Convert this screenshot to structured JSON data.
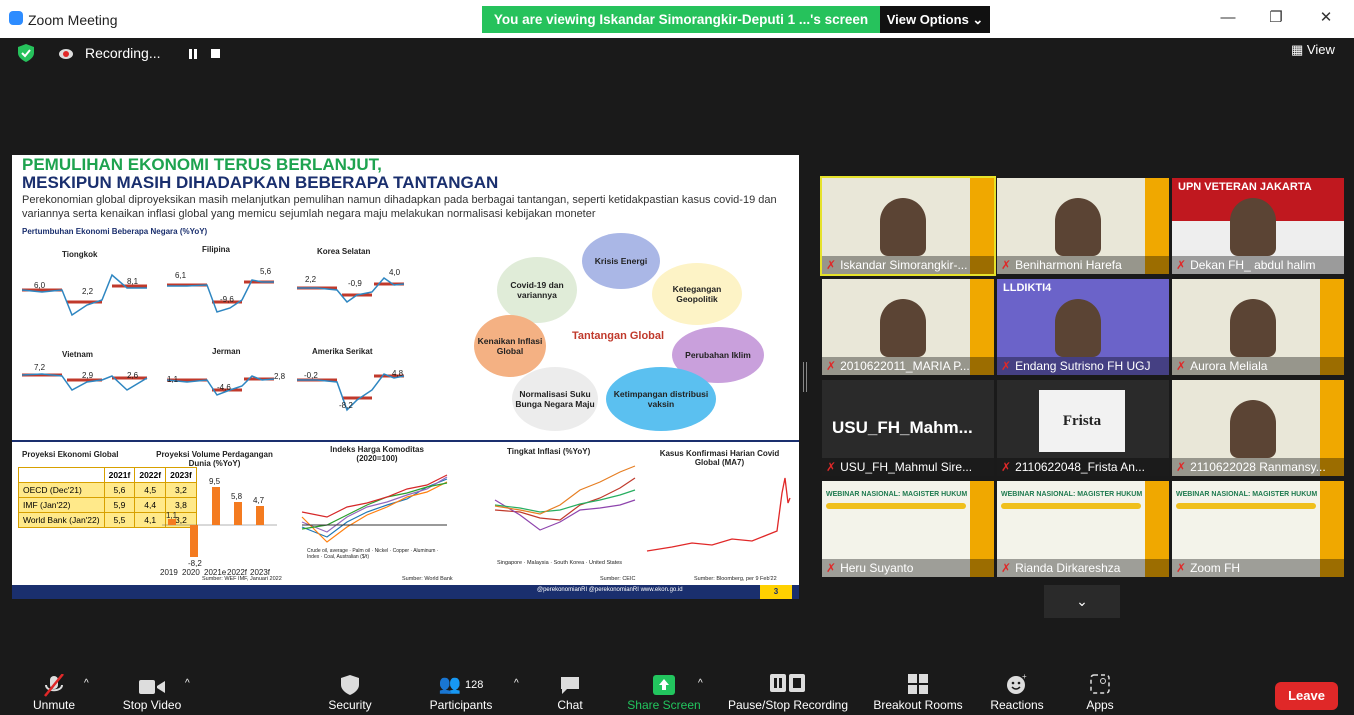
{
  "window": {
    "title": "Zoom Meeting"
  },
  "banner": {
    "text": "You are viewing Iskandar Simorangkir-Deputi 1 ...'s screen",
    "view_options": "View Options ⌄"
  },
  "recording": {
    "label": "Recording...",
    "view_label": "View"
  },
  "slide": {
    "title_line1": "PEMULIHAN EKONOMI TERUS BERLANJUT,",
    "title_line2": "MESKIPUN MASIH DIHADAPKAN BEBERAPA TANTANGAN",
    "paragraph": "Perekonomian global diproyeksikan masih melanjutkan pemulihan namun dihadapkan pada berbagai tantangan, seperti ketidakpastian kasus covid-19 dan variannya serta kenaikan inflasi global yang memicu sejumlah negara maju melakukan normalisasi kebijakan moneter",
    "growth_title": "Pertumbuhan Ekonomi Beberapa Negara (%YoY)",
    "countries": [
      "Tiongkok",
      "Filipina",
      "Korea Selatan",
      "Vietnam",
      "Jerman",
      "Amerika Serikat"
    ],
    "country_values": [
      [
        "6,0",
        "2,2",
        "8,1"
      ],
      [
        "6,1",
        "-9,6",
        "5,6"
      ],
      [
        "2,2",
        "-0,9",
        "4,0"
      ],
      [
        "7,2",
        "2,9",
        "2,6"
      ],
      [
        "1,1",
        "-4,6",
        "2,8"
      ],
      [
        "-0,2",
        "-8,2",
        "4,8"
      ]
    ],
    "challenges": [
      "Krisis Energi",
      "Covid-19 dan variannya",
      "Ketegangan Geopolitik",
      "Kenaikan Inflasi Global",
      "Perubahan Iklim",
      "Normalisasi Suku Bunga Negara Maju",
      "Ketimpangan distribusi vaksin"
    ],
    "challenges_center": "Tantangan Global",
    "proyeksi_title": "Proyeksi Ekonomi Global",
    "proyeksi_headers": [
      "",
      "2021f",
      "2022f",
      "2023f"
    ],
    "proyeksi_rows": [
      [
        "OECD (Dec'21)",
        "5,6",
        "4,5",
        "3,2"
      ],
      [
        "IMF (Jan'22)",
        "5,9",
        "4,4",
        "3,8"
      ],
      [
        "World Bank (Jan'22)",
        "5,5",
        "4,1",
        "3,2"
      ]
    ],
    "trade_title": "Proyeksi Volume Perdagangan Dunia (%YoY)",
    "trade_values": [
      "1,1",
      "-8,2",
      "9,5",
      "5,8",
      "4,7"
    ],
    "trade_years": [
      "2019",
      "2020",
      "2021e",
      "2022f",
      "2023f"
    ],
    "trade_source": "Sumber: WEF IMF, Januari 2022",
    "commodity_title": "Indeks Harga Komoditas (2020=100)",
    "commodity_legend": [
      "Crude oil, average",
      "Palm oil",
      "Nickel",
      "Copper",
      "Aluminum",
      "Index",
      "Coal, Australian ($/t)"
    ],
    "commodity_source": "Sumber: World Bank",
    "inflation_title": "Tingkat Inflasi (%YoY)",
    "inflation_legend": [
      "Singapore",
      "Malaysia",
      "South Korea",
      "United States"
    ],
    "inflation_source": "Sumber: CEIC",
    "covid_title": "Kasus Konfirmasi Harian Covid Global (MA7)",
    "covid_source": "Sumber: Bloomberg, per 9 Feb'22",
    "footer_text": "@perekonomianRI  @perekonomianRI  www.ekon.go.id",
    "page_number": "3"
  },
  "participants": [
    {
      "name": "Iskandar Simorangkir-...",
      "kind": "camera",
      "active": true
    },
    {
      "name": "Beniharmoni Harefa",
      "kind": "camera"
    },
    {
      "name": "Dekan FH_ abdul halim",
      "kind": "camera",
      "header": "UPN VETERAN JAKARTA"
    },
    {
      "name": "2010622011_MARIA P...",
      "kind": "camera"
    },
    {
      "name": "Endang Sutrisno FH UGJ",
      "kind": "camera",
      "header": "LLDIKTI4"
    },
    {
      "name": "Aurora Meliala",
      "kind": "camera"
    },
    {
      "name": "USU_FH_Mahmul Sire...",
      "kind": "text",
      "display": "USU_FH_Mahm..."
    },
    {
      "name": "2110622048_Frista An...",
      "kind": "card",
      "display": "Frista"
    },
    {
      "name": "2110622028 Ranmansy...",
      "kind": "camera"
    },
    {
      "name": "Heru Suyanto",
      "kind": "webinar"
    },
    {
      "name": "Rianda Dirkareshza",
      "kind": "webinar"
    },
    {
      "name": "Zoom FH",
      "kind": "webinar"
    }
  ],
  "webinar_text": "WEBINAR NASIONAL: MAGISTER HUKUM",
  "toolbar": {
    "unmute": "Unmute",
    "stop_video": "Stop Video",
    "security": "Security",
    "participants": "Participants",
    "participants_count": "128",
    "chat": "Chat",
    "share_screen": "Share Screen",
    "pause_recording": "Pause/Stop Recording",
    "breakout": "Breakout Rooms",
    "reactions": "Reactions",
    "apps": "Apps",
    "leave": "Leave"
  },
  "colors": {
    "accent_green": "#26c25c",
    "leave_red": "#e02828",
    "toolbar_bg": "#1a1a1a",
    "share_green": "#22c55e"
  }
}
